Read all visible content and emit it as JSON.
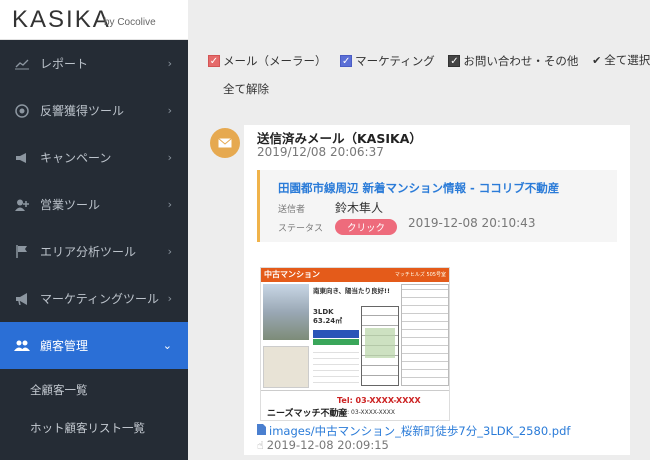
{
  "brand": {
    "logo": "KASIKA",
    "sub": "by Cocolive"
  },
  "sidebar": {
    "items": [
      {
        "label": "レポート",
        "icon": "chart-icon"
      },
      {
        "label": "反響獲得ツール",
        "icon": "target-icon"
      },
      {
        "label": "キャンペーン",
        "icon": "megaphone-icon"
      },
      {
        "label": "営業ツール",
        "icon": "user-plus-icon"
      },
      {
        "label": "エリア分析ツール",
        "icon": "flag-icon"
      },
      {
        "label": "マーケティングツール",
        "icon": "bullhorn-icon"
      },
      {
        "label": "顧客管理",
        "icon": "users-icon"
      }
    ],
    "subitems": [
      "全顧客一覧",
      "ホット顧客リスト一覧"
    ]
  },
  "filters": {
    "mail": "メール（メーラー）",
    "marketing": "マーケティング",
    "inquiry": "お問い合わせ・その他",
    "select_all": "全て選択",
    "deselect_all": "全て解除"
  },
  "timeline": {
    "title": "送信済みメール（KASIKA）",
    "date": "2019/12/08 20:06:37",
    "mail": {
      "subject": "田園都市線周辺 新着マンション情報 - ココリブ不動産",
      "sender_label": "送信者",
      "sender": "鈴木隼人",
      "status_label": "ステータス",
      "status_badge": "クリック",
      "status_time": "2019-12-08 20:10:43"
    },
    "flyer": {
      "header": "中古マンション",
      "header_sub": "マッチヒルズ 505号室",
      "catch": "南東向き、陽当たり良好!!",
      "layout": "3LDK",
      "area": "63.24㎡",
      "company": "ニーズマッチ不動産",
      "tel": "Tel: 03-XXXX-XXXX",
      "fax": "Fax: 03-XXXX-XXXX"
    },
    "file": "images/中古マンション_桜新町徒歩7分_3LDK_2580.pdf",
    "file_time": "2019-12-08 20:09:15"
  }
}
